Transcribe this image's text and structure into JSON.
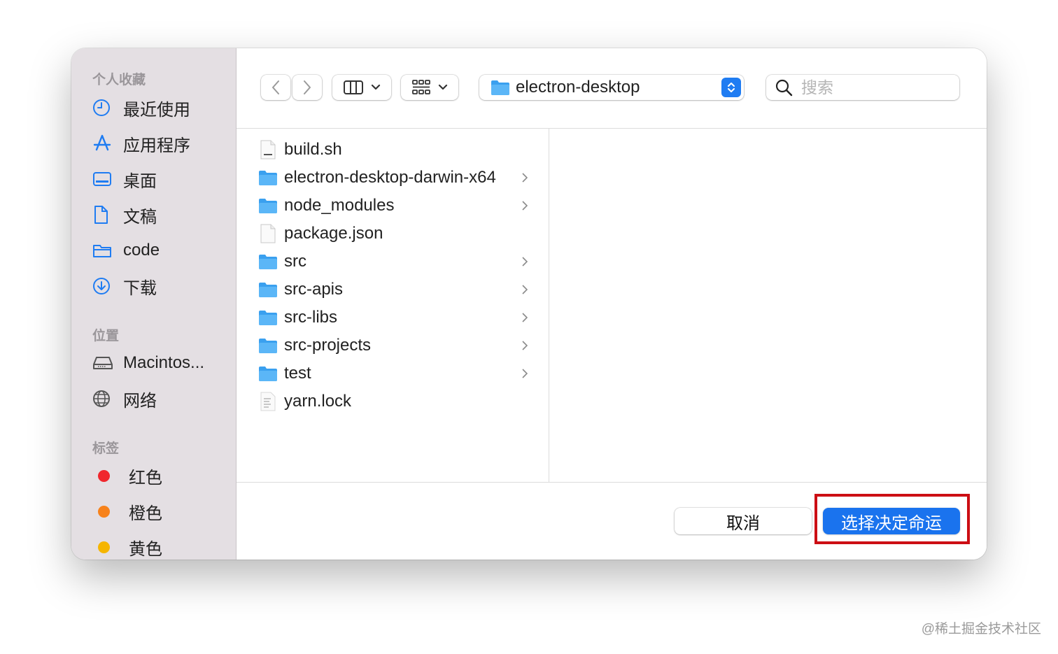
{
  "sidebar": {
    "favorites_title": "个人收藏",
    "favorites": [
      {
        "label": "最近使用",
        "icon": "clock-icon"
      },
      {
        "label": "应用程序",
        "icon": "applications-icon"
      },
      {
        "label": "桌面",
        "icon": "desktop-icon"
      },
      {
        "label": "文稿",
        "icon": "document-icon"
      },
      {
        "label": "code",
        "icon": "folder-icon"
      },
      {
        "label": "下载",
        "icon": "download-icon"
      }
    ],
    "locations_title": "位置",
    "locations": [
      {
        "label": "Macintos...",
        "icon": "hard-drive-icon"
      },
      {
        "label": "网络",
        "icon": "globe-icon"
      }
    ],
    "tags_title": "标签",
    "tags": [
      {
        "label": "红色",
        "color": "#f0272d"
      },
      {
        "label": "橙色",
        "color": "#f7821b"
      },
      {
        "label": "黄色",
        "color": "#f5b500"
      }
    ]
  },
  "toolbar": {
    "location": "electron-desktop",
    "search_placeholder": "搜索"
  },
  "files": [
    {
      "name": "build.sh",
      "kind": "file"
    },
    {
      "name": "electron-desktop-darwin-x64",
      "kind": "folder"
    },
    {
      "name": "node_modules",
      "kind": "folder"
    },
    {
      "name": "package.json",
      "kind": "file"
    },
    {
      "name": "src",
      "kind": "folder"
    },
    {
      "name": "src-apis",
      "kind": "folder"
    },
    {
      "name": "src-libs",
      "kind": "folder"
    },
    {
      "name": "src-projects",
      "kind": "folder"
    },
    {
      "name": "test",
      "kind": "folder"
    },
    {
      "name": "yarn.lock",
      "kind": "file"
    }
  ],
  "footer": {
    "cancel_label": "取消",
    "primary_label": "选择决定命运"
  },
  "colors": {
    "accent": "#1a73ee",
    "folder": "#3aa0ef",
    "highlight": "#cc0e14"
  },
  "watermark": "@稀土掘金技术社区"
}
